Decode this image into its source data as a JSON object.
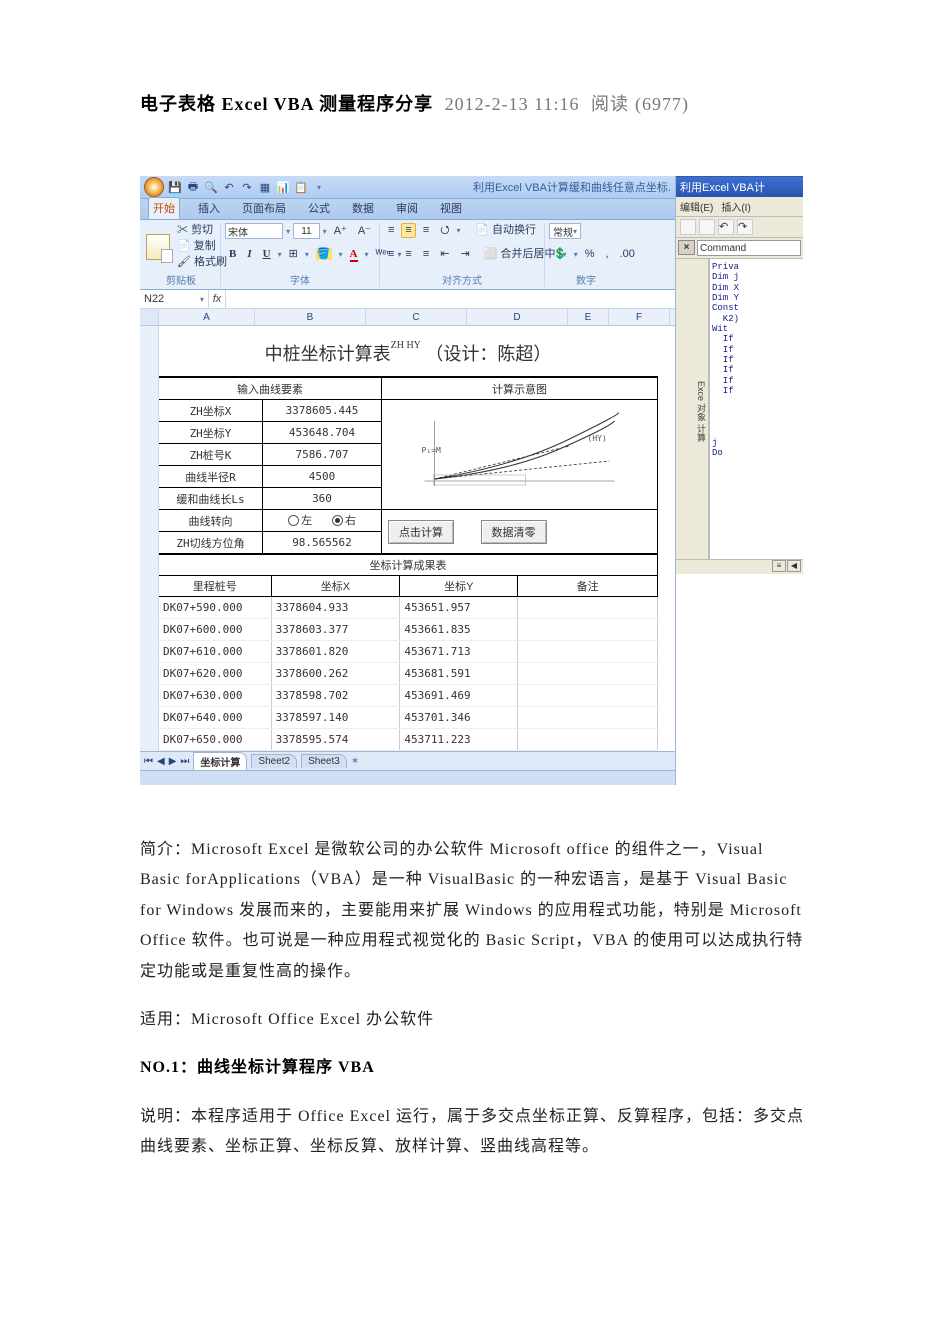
{
  "title": {
    "main": "电子表格 Excel VBA 测量程序分享",
    "date": "2012-2-13 11:16",
    "reads_label": "阅读",
    "reads_count": "6977"
  },
  "excel": {
    "window_title": "利用Excel VBA计算缓和曲线任意点坐标.",
    "qat": [
      "save",
      "print",
      "undo",
      "redo",
      "table",
      "chart",
      "paste"
    ],
    "tabs": {
      "active": "开始",
      "items": [
        "开始",
        "插入",
        "页面布局",
        "公式",
        "数据",
        "审阅",
        "视图"
      ]
    },
    "clipboard": {
      "cut": "剪切",
      "copy": "复制",
      "format_painter": "格式刷",
      "paste": "粘贴",
      "group": "剪贴板"
    },
    "font": {
      "family": "宋体",
      "size": "11",
      "group": "字体"
    },
    "align": {
      "wrap": "自动换行",
      "merge": "合并后居中",
      "group": "对齐方式"
    },
    "number": {
      "format": "常规",
      "group": "数字"
    },
    "namebox": "N22",
    "columns": [
      "A",
      "B",
      "C",
      "D",
      "E",
      "F"
    ],
    "sheet_title": "中桩坐标计算表",
    "sheet_title_superscript": "ZH HY",
    "sheet_designer_label": "（设计：陈超）",
    "section_inputs": "输入曲线要素",
    "section_diagram": "计算示意图",
    "params": [
      {
        "label": "ZH坐标X",
        "value": "3378605.445"
      },
      {
        "label": "ZH坐标Y",
        "value": "453648.704"
      },
      {
        "label": "ZH桩号K",
        "value": "7586.707"
      },
      {
        "label": "曲线半径R",
        "value": "4500"
      },
      {
        "label": "缓和曲线长Ls",
        "value": "360"
      }
    ],
    "turn_label": "曲线转向",
    "turn_left": "左",
    "turn_right": "右",
    "turn_value": "右",
    "azimuth_label": "ZH切线方位角",
    "azimuth_value": "98.565562",
    "btn_calc": "点击计算",
    "btn_clear": "数据清零",
    "section_results": "坐标计算成果表",
    "result_headers": [
      "里程桩号",
      "坐标X",
      "坐标Y",
      "备注"
    ],
    "results": [
      {
        "m": "DK07+590.000",
        "x": "3378604.933",
        "y": "453651.957"
      },
      {
        "m": "DK07+600.000",
        "x": "3378603.377",
        "y": "453661.835"
      },
      {
        "m": "DK07+610.000",
        "x": "3378601.820",
        "y": "453671.713"
      },
      {
        "m": "DK07+620.000",
        "x": "3378600.262",
        "y": "453681.591"
      },
      {
        "m": "DK07+630.000",
        "x": "3378598.702",
        "y": "453691.469"
      },
      {
        "m": "DK07+640.000",
        "x": "3378597.140",
        "y": "453701.346"
      },
      {
        "m": "DK07+650.000",
        "x": "3378595.574",
        "y": "453711.223"
      }
    ],
    "sheet_tabs": [
      "坐标计算",
      "Sheet2",
      "Sheet3"
    ],
    "diagram_labels": {
      "p1": "P₁=M",
      "other": "(HY)"
    }
  },
  "vbe": {
    "window_title": "利用Excel VBA计",
    "menu": [
      "编辑(E)",
      "插入(I)"
    ],
    "dropdown": "Command",
    "explorer_label": "Exce\n对象\n计算",
    "code_lines": [
      "Priva",
      "Dim j",
      "Dim X",
      "Dim Y",
      "Const",
      "  K2)",
      "Wit",
      "  If",
      "  If",
      "  If",
      "  If",
      "  If",
      "  If",
      "",
      "",
      "",
      "",
      "j",
      "Do"
    ]
  },
  "paragraphs": {
    "intro": "简介：Microsoft Excel 是微软公司的办公软件 Microsoft office 的组件之一，Visual Basic forApplications（VBA）是一种 VisualBasic 的一种宏语言，是基于 Visual Basic for Windows 发展而来的，主要能用来扩展 Windows 的应用程式功能，特别是 Microsoft Office 软件。也可说是一种应用程式视觉化的 Basic Script，VBA 的使用可以达成执行特定功能或是重复性高的操作。",
    "applicable": "适用：Microsoft Office Excel 办公软件",
    "no1": "NO.1：曲线坐标计算程序 VBA",
    "desc": "说明：本程序适用于 Office Excel 运行，属于多交点坐标正算、反算程序，包括：多交点曲线要素、坐标正算、坐标反算、放样计算、竖曲线高程等。"
  }
}
